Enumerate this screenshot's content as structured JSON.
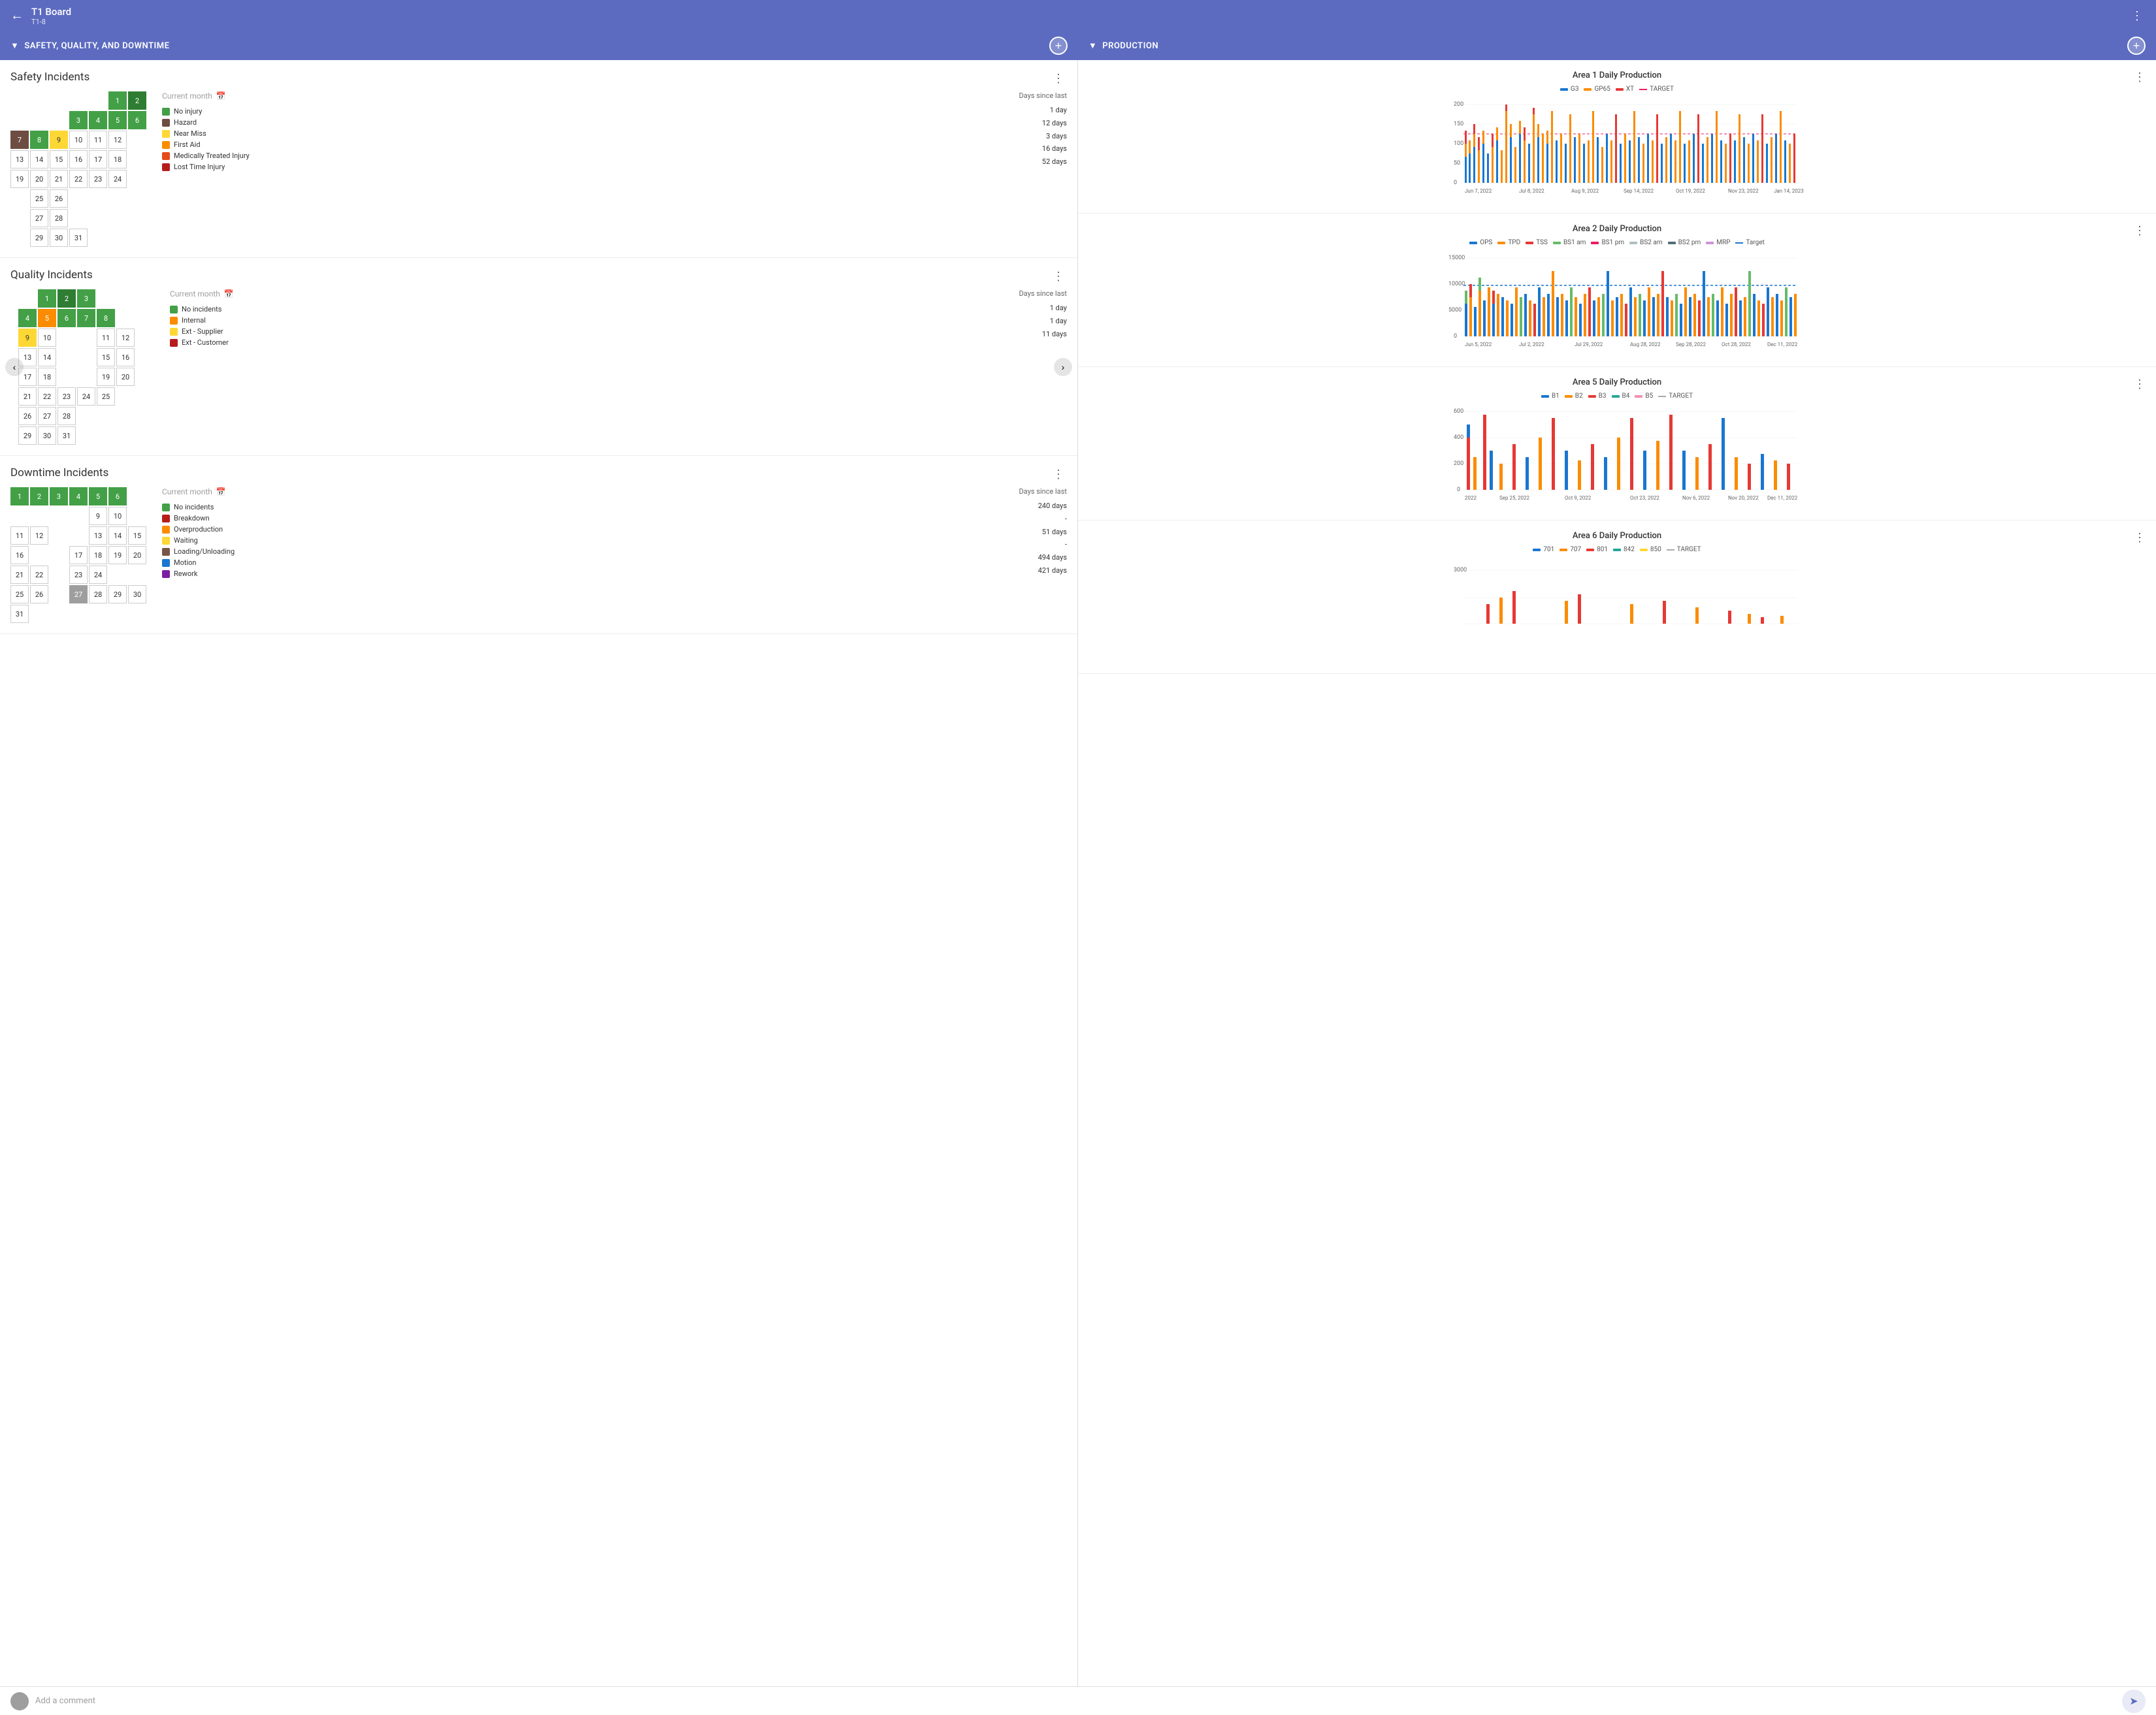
{
  "app": {
    "title": "T1 Board",
    "subtitle": "T1-8",
    "back_label": "←",
    "more_label": "⋮"
  },
  "sections": {
    "left_header": "SAFETY, QUALITY, AND DOWNTIME",
    "right_header": "PRODUCTION"
  },
  "safety": {
    "title": "Safety Incidents",
    "month_label": "Current month",
    "days_since_label": "Days since last",
    "legend": [
      {
        "label": "No injury",
        "color": "#43a047",
        "days": ""
      },
      {
        "label": "Hazard",
        "color": "#6d4c41",
        "days": "1 day"
      },
      {
        "label": "Near Miss",
        "color": "#fdd835",
        "days": "12 days"
      },
      {
        "label": "First Aid",
        "color": "#fb8c00",
        "days": "3 days"
      },
      {
        "label": "Medically Treated Injury",
        "color": "#e64a19",
        "days": "16 days"
      },
      {
        "label": "Lost Time Injury",
        "color": "#b71c1c",
        "days": "52 days"
      }
    ],
    "calendar": [
      {
        "day": 1,
        "type": "green"
      },
      {
        "day": 2,
        "type": "dark-green"
      },
      {
        "day": 3,
        "type": "green"
      },
      {
        "day": 4,
        "type": "green"
      },
      {
        "day": 5,
        "type": "green"
      },
      {
        "day": 6,
        "type": "green"
      },
      {
        "day": 7,
        "type": "brown"
      },
      {
        "day": 8,
        "type": "green"
      },
      {
        "day": 9,
        "type": "yellow"
      },
      {
        "day": 10,
        "type": ""
      },
      {
        "day": 11,
        "type": ""
      },
      {
        "day": 12,
        "type": ""
      },
      {
        "day": 13,
        "type": ""
      },
      {
        "day": 14,
        "type": ""
      },
      {
        "day": 15,
        "type": ""
      },
      {
        "day": 16,
        "type": ""
      },
      {
        "day": 17,
        "type": ""
      },
      {
        "day": 18,
        "type": ""
      },
      {
        "day": 19,
        "type": ""
      },
      {
        "day": 20,
        "type": ""
      },
      {
        "day": 21,
        "type": ""
      },
      {
        "day": 22,
        "type": ""
      },
      {
        "day": 23,
        "type": ""
      },
      {
        "day": 24,
        "type": ""
      },
      {
        "day": 25,
        "type": ""
      },
      {
        "day": 26,
        "type": ""
      },
      {
        "day": 27,
        "type": ""
      },
      {
        "day": 28,
        "type": ""
      },
      {
        "day": 29,
        "type": ""
      },
      {
        "day": 30,
        "type": ""
      },
      {
        "day": 31,
        "type": ""
      }
    ]
  },
  "quality": {
    "title": "Quality Incidents",
    "month_label": "Current month",
    "days_since_label": "Days since last",
    "legend": [
      {
        "label": "No incidents",
        "color": "#43a047",
        "days": ""
      },
      {
        "label": "Internal",
        "color": "#fb8c00",
        "days": "1 day"
      },
      {
        "label": "Ext - Supplier",
        "color": "#fdd835",
        "days": "1 day"
      },
      {
        "label": "Ext - Customer",
        "color": "#b71c1c",
        "days": "11 days"
      }
    ]
  },
  "downtime": {
    "title": "Downtime Incidents",
    "month_label": "Current month",
    "days_since_label": "Days since last",
    "legend": [
      {
        "label": "No incidents",
        "color": "#43a047",
        "days": ""
      },
      {
        "label": "Breakdown",
        "color": "#b71c1c",
        "days": "240 days"
      },
      {
        "label": "Overproduction",
        "color": "#fb8c00",
        "days": "-"
      },
      {
        "label": "Waiting",
        "color": "#fdd835",
        "days": "51 days"
      },
      {
        "label": "Loading/Unloading",
        "color": "#795548",
        "days": "-"
      },
      {
        "label": "Motion",
        "color": "#1976d2",
        "days": "494 days"
      },
      {
        "label": "Rework",
        "color": "#7b1fa2",
        "days": "421 days"
      }
    ]
  },
  "charts": {
    "area1": {
      "title": "Area 1 Daily Production",
      "legend": [
        {
          "label": "G3",
          "color": "#1976d2",
          "type": "bar"
        },
        {
          "label": "GP65",
          "color": "#fb8c00",
          "type": "bar"
        },
        {
          "label": "XT",
          "color": "#e53935",
          "type": "bar"
        },
        {
          "label": "TARGET",
          "color": "#e91e63",
          "type": "dash"
        }
      ],
      "x_labels": [
        "Jun 7, 2022",
        "Jul 8, 2022",
        "Aug 9, 2022",
        "Sep 14, 2022",
        "Oct 19, 2022",
        "Nov 23, 2022",
        "Jan 14, 2023"
      ],
      "y_max": 200,
      "y_labels": [
        "200",
        "150",
        "100",
        "50",
        "0"
      ]
    },
    "area2": {
      "title": "Area 2 Daily Production",
      "legend": [
        {
          "label": "OPS",
          "color": "#1976d2",
          "type": "bar"
        },
        {
          "label": "TPD",
          "color": "#fb8c00",
          "type": "bar"
        },
        {
          "label": "TSS",
          "color": "#e53935",
          "type": "bar"
        },
        {
          "label": "BS1 am",
          "color": "#66bb6a",
          "type": "bar"
        },
        {
          "label": "BS1 pm",
          "color": "#e91e63",
          "type": "bar"
        },
        {
          "label": "BS2 am",
          "color": "#b0bec5",
          "type": "bar"
        },
        {
          "label": "BS2 pm",
          "color": "#546e7a",
          "type": "bar"
        },
        {
          "label": "MRP",
          "color": "#ce93d8",
          "type": "bar"
        },
        {
          "label": "Target",
          "color": "#1976d2",
          "type": "dash"
        }
      ],
      "x_labels": [
        "Jun 5, 2022",
        "Jul 2, 2022",
        "Jul 29, 2022",
        "Aug 28, 2022",
        "Sep 28, 2022",
        "Oct 28, 2022",
        "Dec 11, 2022"
      ],
      "y_max": 15000,
      "y_labels": [
        "15000",
        "10000",
        "5000",
        "0"
      ]
    },
    "area5": {
      "title": "Area 5 Daily Production",
      "legend": [
        {
          "label": "B1",
          "color": "#1976d2",
          "type": "bar"
        },
        {
          "label": "B2",
          "color": "#fb8c00",
          "type": "bar"
        },
        {
          "label": "B3",
          "color": "#e53935",
          "type": "bar"
        },
        {
          "label": "B4",
          "color": "#26a69a",
          "type": "bar"
        },
        {
          "label": "B5",
          "color": "#f48fb1",
          "type": "bar"
        },
        {
          "label": "TARGET",
          "color": "#aaa",
          "type": "dash"
        }
      ],
      "x_labels": [
        "2022",
        "Sep 25, 2022",
        "Oct 9, 2022",
        "Oct 23, 2022",
        "Nov 6, 2022",
        "Nov 20, 2022",
        "Dec 11, 2022"
      ],
      "y_max": 600,
      "y_labels": [
        "600",
        "400",
        "200",
        "0"
      ]
    },
    "area6": {
      "title": "Area 6 Daily Production",
      "legend": [
        {
          "label": "701",
          "color": "#1976d2",
          "type": "bar"
        },
        {
          "label": "707",
          "color": "#fb8c00",
          "type": "bar"
        },
        {
          "label": "801",
          "color": "#e53935",
          "type": "bar"
        },
        {
          "label": "842",
          "color": "#26a69a",
          "type": "bar"
        },
        {
          "label": "850",
          "color": "#fdd835",
          "type": "bar"
        },
        {
          "label": "TARGET",
          "color": "#aaa",
          "type": "dash"
        }
      ],
      "x_labels": [],
      "y_max": 3000,
      "y_labels": [
        "3000",
        ""
      ]
    }
  },
  "bottom": {
    "comment_placeholder": "Add a comment",
    "send_icon": "➤"
  }
}
